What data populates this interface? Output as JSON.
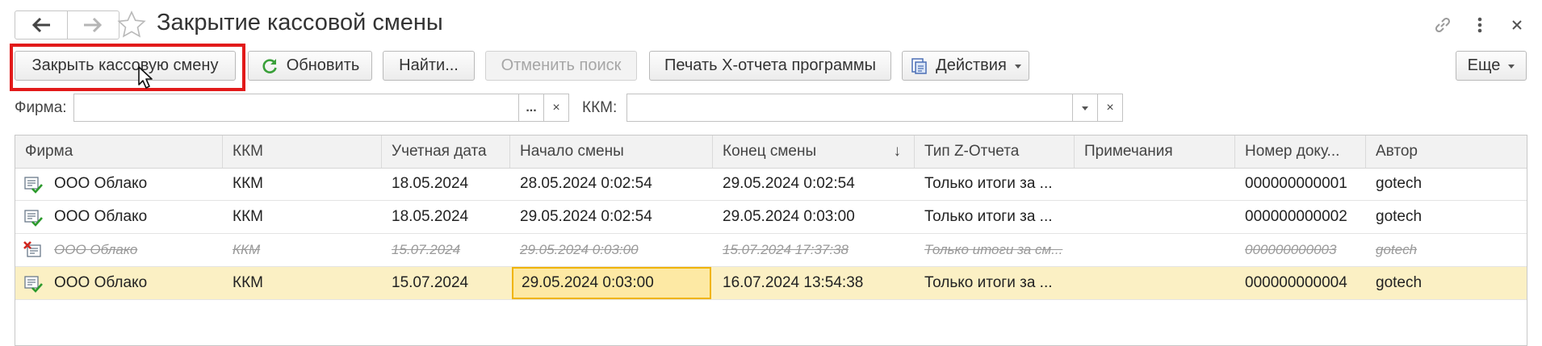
{
  "window": {
    "title": "Закрытие кассовой смены"
  },
  "toolbar": {
    "close_shift": "Закрыть кассовую смену",
    "refresh": "Обновить",
    "find": "Найти...",
    "cancel_search": "Отменить поиск",
    "print_x": "Печать X-отчета программы",
    "actions": "Действия",
    "more": "Еще"
  },
  "filters": {
    "firm_label": "Фирма:",
    "firm_value": "",
    "firm_select_button": "...",
    "firm_clear_button": "×",
    "kkm_label": "ККМ:",
    "kkm_value": "",
    "kkm_clear_button": "×"
  },
  "table": {
    "columns": [
      "Фирма",
      "ККМ",
      "Учетная дата",
      "Начало смены",
      "Конец смены",
      "Тип Z-Отчета",
      "Примечания",
      "Номер доку...",
      "Автор"
    ],
    "sort_indicator": "↓",
    "rows": [
      {
        "status": "posted",
        "firm": "ООО Облако",
        "kkm": "ККМ",
        "date": "18.05.2024",
        "start": "28.05.2024 0:02:54",
        "end": "29.05.2024 0:02:54",
        "ztype": "Только итоги за ...",
        "notes": "",
        "number": "000000000001",
        "author": "gotech"
      },
      {
        "status": "posted",
        "firm": "ООО Облако",
        "kkm": "ККМ",
        "date": "18.05.2024",
        "start": "29.05.2024 0:02:54",
        "end": "29.05.2024 0:03:00",
        "ztype": "Только итоги за ...",
        "notes": "",
        "number": "000000000002",
        "author": "gotech"
      },
      {
        "status": "deleted",
        "firm": "ООО Облако",
        "kkm": "ККМ",
        "date": "15.07.2024",
        "start": "29.05.2024 0:03:00",
        "end": "15.07.2024 17:37:38",
        "ztype": "Только итоги за см...",
        "notes": "",
        "number": "000000000003",
        "author": "gotech"
      },
      {
        "status": "posted",
        "firm": "ООО Облако",
        "kkm": "ККМ",
        "date": "15.07.2024",
        "start": "29.05.2024 0:03:00",
        "end": "16.07.2024 13:54:38",
        "ztype": "Только итоги за ...",
        "notes": "",
        "number": "000000000004",
        "author": "gotech",
        "selected": true
      }
    ]
  },
  "colors": {
    "highlight_frame": "#e21a1a",
    "selected_row": "#fbf0c4",
    "focused_cell": "#fde9a4",
    "refresh_icon": "#3aa03a"
  }
}
